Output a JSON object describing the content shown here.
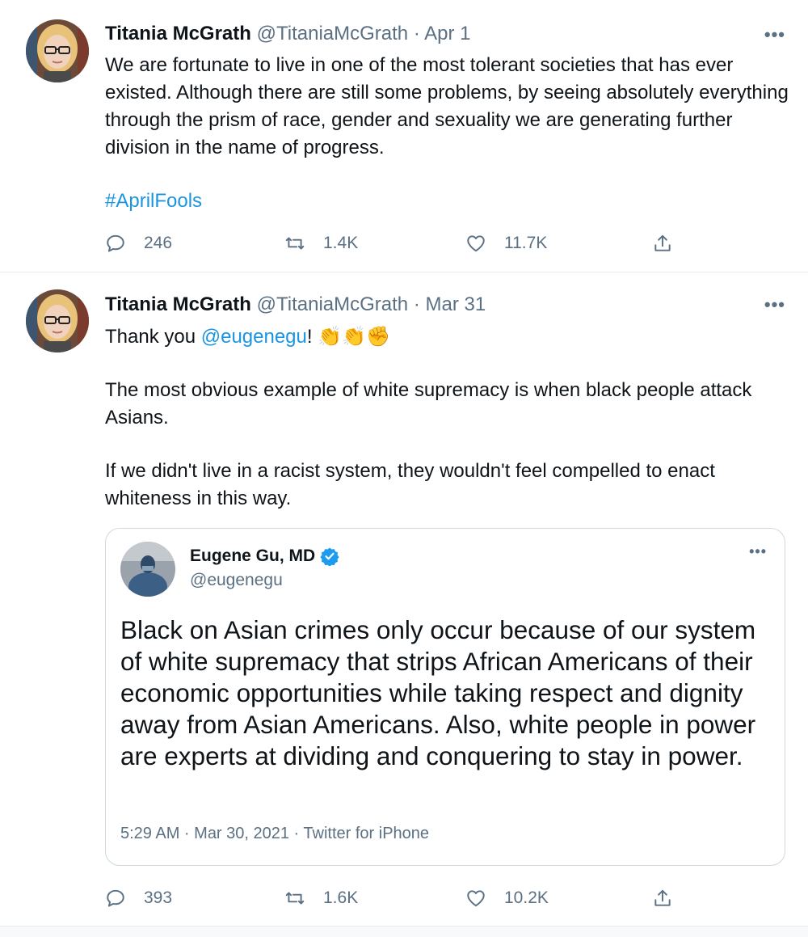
{
  "colors": {
    "link": "#1b95e0",
    "secondary_text": "#5b7083",
    "verified": "#1d9bf0",
    "border": "#cfd9de"
  },
  "tweets": [
    {
      "author_name": "Titania McGrath",
      "author_handle": "@TitaniaMcGrath",
      "separator": "·",
      "date": "Apr 1",
      "more_label": "•••",
      "body": "We are fortunate to live in one of the most tolerant societies that has ever existed. Although there are still some problems, by seeing absolutely everything through the prism of race, gender and sexuality we are generating further division in the name of progress.",
      "hashtag": "#AprilFools",
      "replies": "246",
      "retweets": "1.4K",
      "likes": "11.7K"
    },
    {
      "author_name": "Titania McGrath",
      "author_handle": "@TitaniaMcGrath",
      "separator": "·",
      "date": "Mar 31",
      "more_label": "•••",
      "body_prefix": "Thank you ",
      "mention": "@eugenegu",
      "body_suffix": "!",
      "emoji": "👏👏✊",
      "paragraph2": "The most obvious example of white supremacy is when black people attack Asians.",
      "paragraph3": "If we didn't live in a racist system, they wouldn't feel compelled to enact whiteness in this way.",
      "replies": "393",
      "retweets": "1.6K",
      "likes": "10.2K",
      "quoted": {
        "author_name": "Eugene Gu, MD",
        "author_handle": "@eugenegu",
        "more_label": "•••",
        "text": "Black on Asian crimes only occur because of our system of white supremacy that strips African Americans of their economic opportunities while taking respect and dignity away from Asian Americans. Also, white people in power are experts at dividing and conquering to stay in power.",
        "meta": "5:29 AM · Mar 30, 2021 · Twitter for iPhone"
      }
    }
  ],
  "icons": [
    "reply-icon",
    "retweet-icon",
    "like-icon",
    "share-icon",
    "verified-badge-icon",
    "more-icon"
  ]
}
